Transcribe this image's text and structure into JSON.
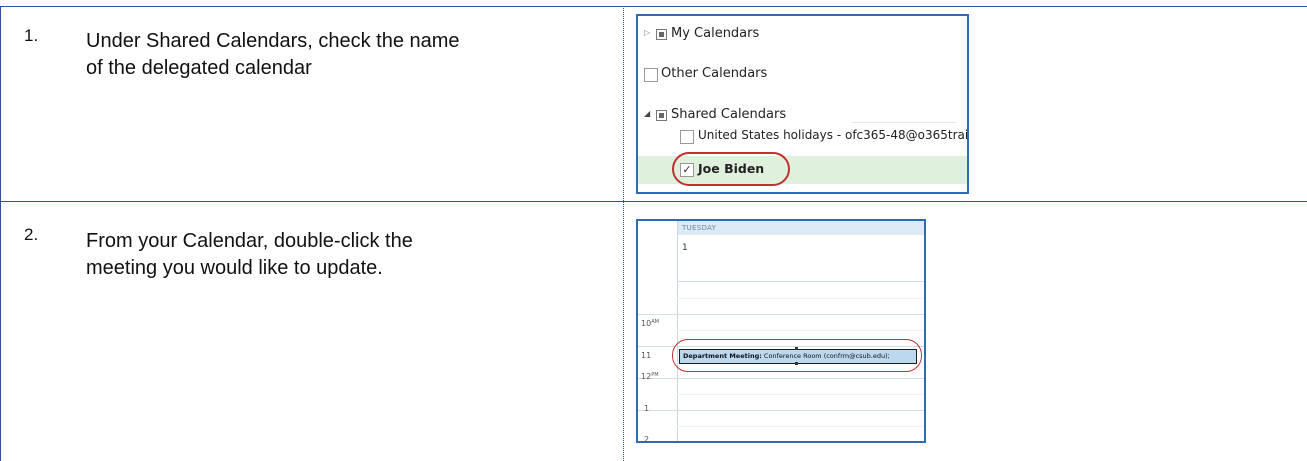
{
  "steps": [
    {
      "number": "1.",
      "line1": "Under Shared Calendars, check the name",
      "line2": "of the delegated calendar"
    },
    {
      "number": "2.",
      "line1": "From your Calendar, double-click the",
      "line2": "meeting you would like to update."
    }
  ],
  "folder_list": {
    "my_calendars": "My Calendars",
    "other_calendars": "Other Calendars",
    "shared_calendars": "Shared Calendars",
    "us_holidays": "United States holidays - ofc365-48@o365traini",
    "delegated": "Joe Biden",
    "checkmark": "✓"
  },
  "day_view": {
    "day_name": "TUESDAY",
    "day_number": "1",
    "hours": [
      {
        "label": "10",
        "suffix": "AM"
      },
      {
        "label": "11",
        "suffix": ""
      },
      {
        "label": "12",
        "suffix": "PM"
      },
      {
        "label": "1",
        "suffix": ""
      },
      {
        "label": "2",
        "suffix": ""
      }
    ],
    "event_title": "Department Meeting:",
    "event_location": " Conference Room (confrm@csub.edu);"
  },
  "colors": {
    "table_border": "#2f5496",
    "highlight_circle": "#c03030",
    "selected_row": "#dff1dd",
    "event_fill": "#bcd8ef"
  }
}
